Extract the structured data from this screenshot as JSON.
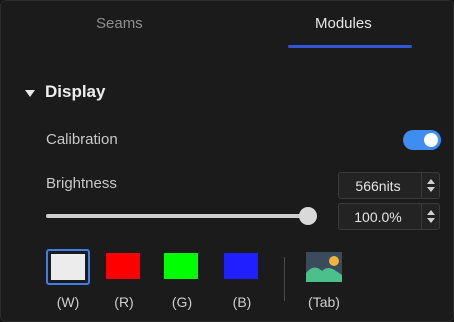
{
  "tabs": [
    {
      "label": "Seams",
      "active": false
    },
    {
      "label": "Modules",
      "active": true
    }
  ],
  "section": {
    "title": "Display",
    "expanded": true
  },
  "calibration": {
    "label": "Calibration",
    "enabled": true
  },
  "brightness": {
    "label": "Brightness",
    "nits": "566nits",
    "percent": "100.0%",
    "slider_fraction": 1.0
  },
  "patterns": [
    {
      "label": "(W)",
      "color": "#ececec",
      "selected": true
    },
    {
      "label": "(R)",
      "color": "#ff0000",
      "selected": false
    },
    {
      "label": "(G)",
      "color": "#00ff00",
      "selected": false
    },
    {
      "label": "(B)",
      "color": "#1f1fff",
      "selected": false
    }
  ],
  "image_pattern": {
    "label": "(Tab)",
    "icon": "landscape-image-icon"
  },
  "colors": {
    "accent": "#2f56d8",
    "toggle": "#3d8ef0"
  }
}
